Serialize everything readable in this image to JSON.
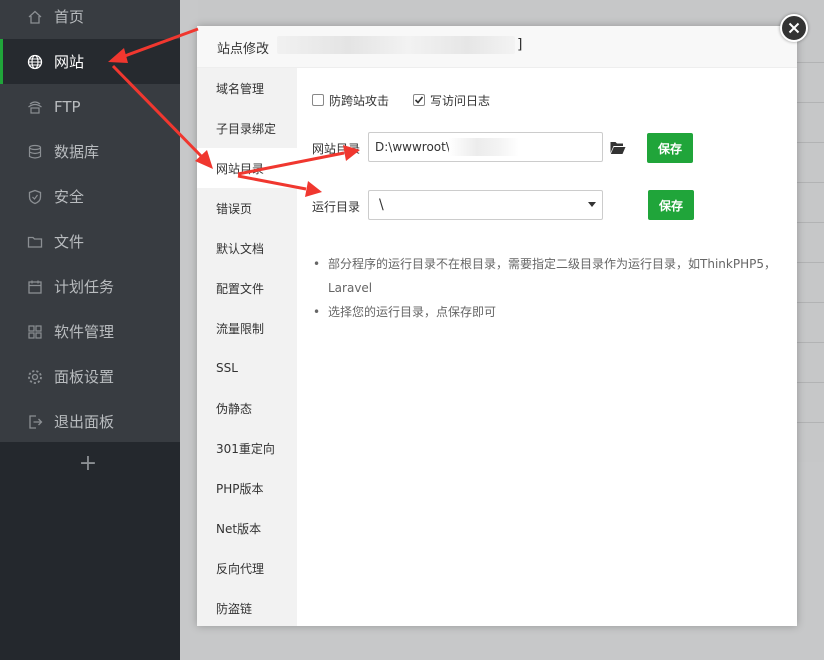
{
  "sidebar": {
    "items": [
      {
        "label": "首页",
        "icon": "home-icon"
      },
      {
        "label": "网站",
        "icon": "globe-icon"
      },
      {
        "label": "FTP",
        "icon": "ftp-icon"
      },
      {
        "label": "数据库",
        "icon": "database-icon"
      },
      {
        "label": "安全",
        "icon": "shield-icon"
      },
      {
        "label": "文件",
        "icon": "folder-icon"
      },
      {
        "label": "计划任务",
        "icon": "calendar-icon"
      },
      {
        "label": "软件管理",
        "icon": "grid-icon"
      },
      {
        "label": "面板设置",
        "icon": "gear-icon"
      },
      {
        "label": "退出面板",
        "icon": "logout-icon"
      }
    ],
    "add_label": "+"
  },
  "modal": {
    "title": "站点修改",
    "title_suffix": "]",
    "menu": [
      "域名管理",
      "子目录绑定",
      "网站目录",
      "错误页",
      "默认文档",
      "配置文件",
      "流量限制",
      "SSL",
      "伪静态",
      "301重定向",
      "PHP版本",
      "Net版本",
      "反向代理",
      "防盗链"
    ],
    "active_menu": "网站目录",
    "checkboxes": [
      {
        "label": "防跨站攻击",
        "checked": false
      },
      {
        "label": "写访问日志",
        "checked": true
      }
    ],
    "site_dir_label": "网站目录",
    "site_dir_value": "D:\\wwwroot\\",
    "run_dir_label": "运行目录",
    "run_dir_value": "\\",
    "save_label": "保存",
    "tips": [
      "部分程序的运行目录不在根目录，需要指定二级目录作为运行目录，如ThinkPHP5，Laravel",
      "选择您的运行目录，点保存即可"
    ]
  },
  "colors": {
    "accent": "#20a53a",
    "sidebar_bg": "#383c41",
    "arrow": "#f0372f"
  }
}
